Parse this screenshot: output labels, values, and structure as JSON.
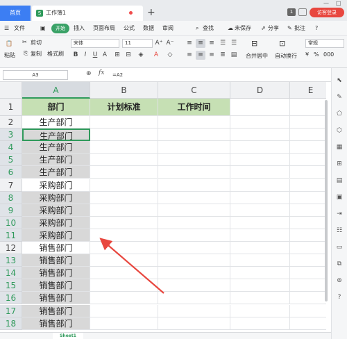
{
  "titlebar": {
    "home_tab": "首页",
    "doc_tab": "工作簿1",
    "doc_icon": "S",
    "close_glyph": "×",
    "add_glyph": "+",
    "badge_number": "1",
    "login_label": "访客登录",
    "min_glyph": "—",
    "max_glyph": "□"
  },
  "menubar": {
    "items": {
      "file": "文件",
      "start": "开始",
      "insert": "插入",
      "page_layout": "页面布局",
      "formulas": "公式",
      "data": "数据",
      "review": "审阅",
      "search": "查找",
      "unsaved": "未保存",
      "share": "分享",
      "comment": "批注",
      "help": "?"
    }
  },
  "ribbon": {
    "cut": "剪切",
    "paste": "粘贴",
    "copy": "复制",
    "format_painter": "格式刷",
    "font_name": "宋体",
    "font_size": "11",
    "merge_center": "合并居中",
    "wrap_text": "自动换行",
    "number_format": "常规",
    "percent": "%",
    "comma": "000"
  },
  "formulabar": {
    "name_box": "A3",
    "fx": "fx",
    "formula": "=A2"
  },
  "sheet": {
    "columns": [
      "A",
      "B",
      "C",
      "D",
      "E"
    ],
    "rows": [
      "1",
      "2",
      "3",
      "4",
      "5",
      "6",
      "7",
      "8",
      "9",
      "10",
      "11",
      "12",
      "13",
      "14",
      "15",
      "16",
      "17",
      "18"
    ],
    "header_row": [
      "部门",
      "计划标准",
      "工作时间"
    ],
    "column_a": [
      "生产部门",
      "生产部门",
      "生产部门",
      "生产部门",
      "生产部门",
      "采购部门",
      "采购部门",
      "采购部门",
      "采购部门",
      "采购部门",
      "销售部门",
      "销售部门",
      "销售部门",
      "销售部门",
      "销售部门",
      "销售部门",
      "销售部门"
    ],
    "active_cell": "A3",
    "highlight_color": "#c6e0b4",
    "selection_color": "#d8d8d8",
    "accent_color": "#2f9a5b",
    "arrow_color": "#e8473f"
  },
  "sheetbar": {
    "tab": "Sheet1"
  },
  "icons": {
    "sidebar": [
      "cursor-icon",
      "pen-icon",
      "shape-icon",
      "cube-icon",
      "table-icon",
      "grid-icon",
      "document-icon",
      "image-icon",
      "export-icon",
      "format-icon",
      "box-icon",
      "stack-icon",
      "filter-icon",
      "question-icon"
    ]
  }
}
